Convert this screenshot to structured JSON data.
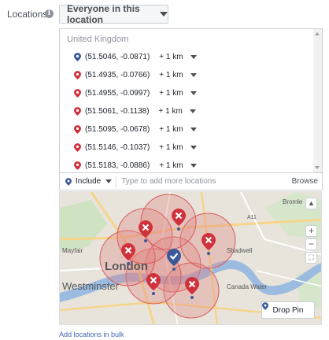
{
  "locations_label": "Locations",
  "scope_button": {
    "label": "Everyone in this location"
  },
  "country": "United Kingdom",
  "location_rows": [
    {
      "coords": "(51.5046, -0.0871)",
      "radius": "+ 1 km",
      "pin_color": "#3b5998"
    },
    {
      "coords": "(51.4935, -0.0766)",
      "radius": "+ 1 km",
      "pin_color": "#d0313a"
    },
    {
      "coords": "(51.4955, -0.0997)",
      "radius": "+ 1 km",
      "pin_color": "#d0313a"
    },
    {
      "coords": "(51.5061, -0.1138)",
      "radius": "+ 1 km",
      "pin_color": "#d0313a"
    },
    {
      "coords": "(51.5095, -0.0678)",
      "radius": "+ 1 km",
      "pin_color": "#d0313a"
    },
    {
      "coords": "(51.5146, -0.1037)",
      "radius": "+ 1 km",
      "pin_color": "#d0313a"
    },
    {
      "coords": "(51.5183, -0.0886)",
      "radius": "+ 1 km",
      "pin_color": "#d0313a"
    }
  ],
  "include_bar": {
    "label": "Include",
    "placeholder": "Type to add more locations",
    "browse": "Browse"
  },
  "map": {
    "labels": {
      "london": "London",
      "westminster": "Westminster",
      "mayfair": "Mayfair",
      "shadwell": "Shadwell",
      "canada_water": "Canada Water",
      "bromley": "Bromle",
      "road_a11": "A11"
    },
    "zoom_in": "+",
    "zoom_out": "−",
    "drop_pin": "Drop Pin"
  },
  "bulk_link": "Add locations in bulk",
  "colors": {
    "accent_blue": "#3b5998",
    "pin_red": "#d0313a",
    "link": "#4267b2"
  }
}
